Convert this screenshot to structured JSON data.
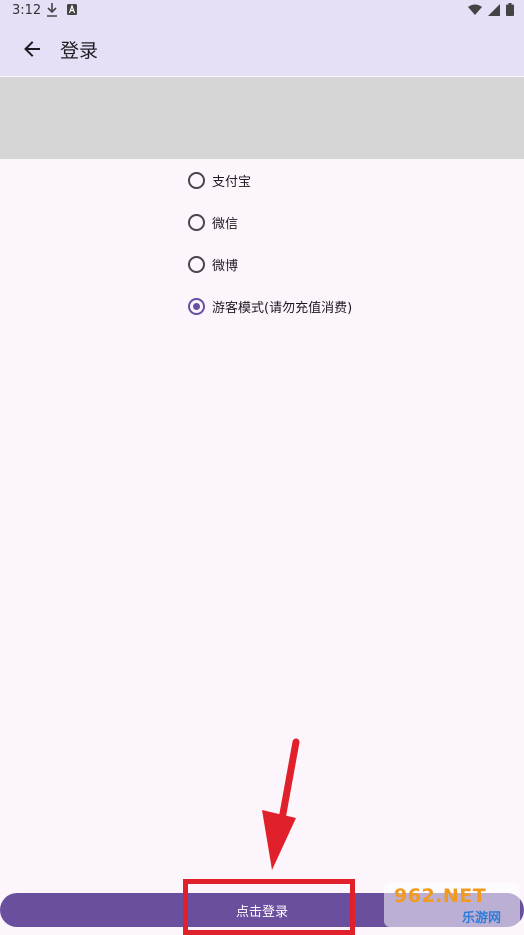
{
  "status_bar": {
    "time": "3:12"
  },
  "app_bar": {
    "title": "登录",
    "back_icon": "arrow-left-icon"
  },
  "login_options": [
    {
      "label": "支付宝",
      "checked": false
    },
    {
      "label": "微信",
      "checked": false
    },
    {
      "label": "微博",
      "checked": false
    },
    {
      "label": "游客模式(请勿充值消费)",
      "checked": true
    }
  ],
  "login_button": {
    "label": "点击登录"
  },
  "watermark": {
    "text": "962.NET",
    "sub": "乐游网"
  },
  "colors": {
    "accent": "#6750a4",
    "button": "#6a4f9f",
    "highlight": "#e0202a"
  }
}
